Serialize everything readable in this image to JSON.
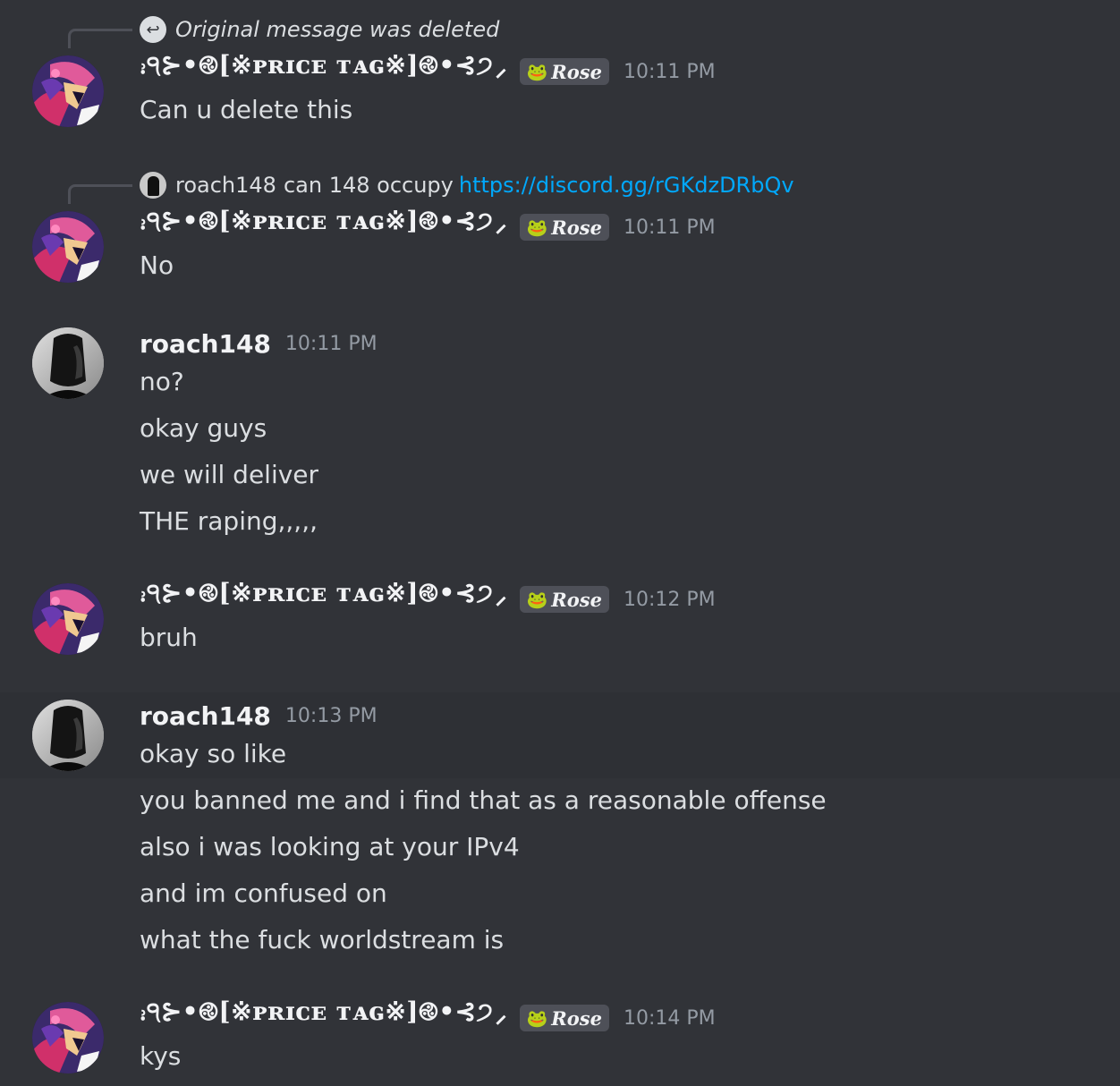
{
  "messages": [
    {
      "reply": {
        "deleted_text": "Original message was deleted"
      },
      "author": "⹌੧⊱•࿋[※ᴘʀɪᴄᴇ ᴛᴀɢ※]࿋•⊰੭⸝",
      "tag": "Rose",
      "tag_icon": "frog-icon",
      "time": "10:11 PM",
      "lines": [
        "Can u delete this"
      ]
    },
    {
      "reply": {
        "author": "roach148",
        "text": "can 148 occupy",
        "link": "https://discord.gg/rGKdzDRbQv"
      },
      "author": "⹌੧⊱•࿋[※ᴘʀɪᴄᴇ ᴛᴀɢ※]࿋•⊰੭⸝",
      "tag": "Rose",
      "time": "10:11 PM",
      "lines": [
        "No"
      ]
    },
    {
      "author": "roach148",
      "time": "10:11 PM",
      "lines": [
        "no?",
        "okay guys",
        "we will deliver",
        "THE raping,,,,,"
      ]
    },
    {
      "author": "⹌੧⊱•࿋[※ᴘʀɪᴄᴇ ᴛᴀɢ※]࿋•⊰੭⸝",
      "tag": "Rose",
      "time": "10:12 PM",
      "lines": [
        "bruh"
      ]
    },
    {
      "author": "roach148",
      "time": "10:13 PM",
      "lines": [
        "okay so like",
        "you banned me and i find that as a reasonable offense",
        "also i was looking at your IPv4",
        "and im confused on",
        "what the fuck worldstream is"
      ]
    },
    {
      "author": "⹌੧⊱•࿋[※ᴘʀɪᴄᴇ ᴛᴀɢ※]࿋•⊰੭⸝",
      "tag": "Rose",
      "time": "10:14 PM",
      "lines": [
        "kys"
      ]
    }
  ],
  "colors": {
    "background": "#313338",
    "hover": "#2e3035",
    "link": "#00a8fc",
    "timestamp": "#949ba4"
  }
}
